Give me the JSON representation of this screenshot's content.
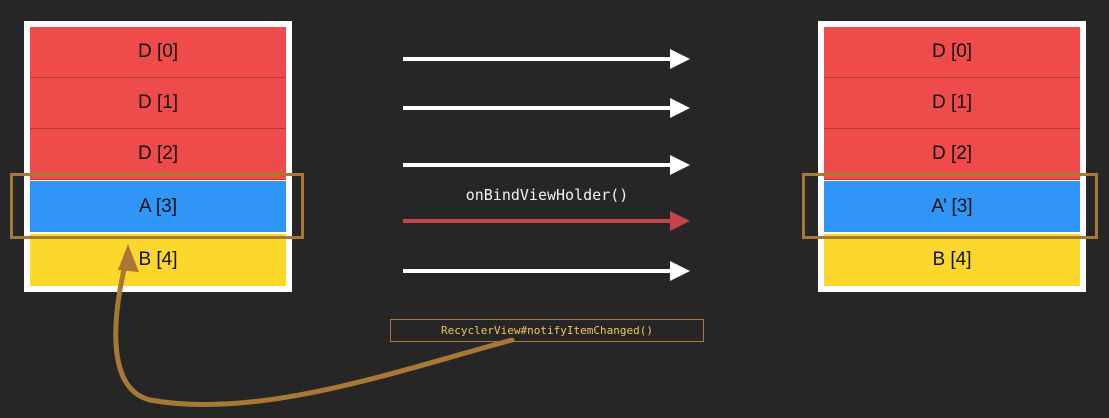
{
  "left_list": {
    "items": [
      {
        "label": "D [0]",
        "color": "#ef4b4b"
      },
      {
        "label": "D [1]",
        "color": "#ef4b4b"
      },
      {
        "label": "D [2]",
        "color": "#ef4b4b"
      },
      {
        "label": "A [3]",
        "color": "#2f95f6"
      },
      {
        "label": "B [4]",
        "color": "#fcd82d"
      }
    ]
  },
  "right_list": {
    "items": [
      {
        "label": "D [0]",
        "color": "#ef4b4b"
      },
      {
        "label": "D [1]",
        "color": "#ef4b4b"
      },
      {
        "label": "D [2]",
        "color": "#ef4b4b"
      },
      {
        "label": "A’ [3]",
        "color": "#2f95f6"
      },
      {
        "label": "B [4]",
        "color": "#fcd82d"
      }
    ]
  },
  "bind_label": "onBindViewHolder()",
  "notify_label": "RecyclerView#notifyItemChanged()",
  "colors": {
    "background": "#262626",
    "arrow_default": "#ffffff",
    "arrow_bind": "#c7424a",
    "highlight": "#a87935",
    "code_text": "#f3c35e"
  }
}
